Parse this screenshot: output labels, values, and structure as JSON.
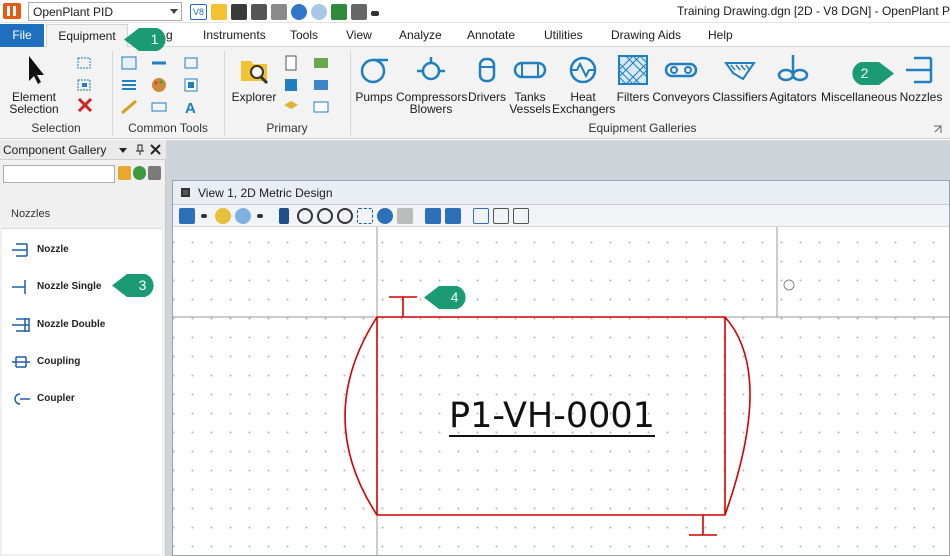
{
  "titlebar": {
    "workset": "OpenPlant PID",
    "window_title": "Training Drawing.dgn [2D - V8 DGN] - OpenPlant P",
    "qat_v8": "V8"
  },
  "tabs": {
    "file": "File",
    "equipment": "Equipment",
    "modeling_fragment": "g",
    "instruments": "Instruments",
    "tools": "Tools",
    "view": "View",
    "analyze": "Analyze",
    "annotate": "Annotate",
    "utilities": "Utilities",
    "drawing_aids": "Drawing Aids",
    "help": "Help"
  },
  "ribbon": {
    "selection": {
      "element_selection_line1": "Element",
      "element_selection_line2": "Selection",
      "label": "Selection"
    },
    "common_tools": {
      "label": "Common Tools"
    },
    "primary": {
      "explorer": "Explorer",
      "label": "Primary"
    },
    "galleries": {
      "pumps": "Pumps",
      "compressors_line1": "Compressors",
      "compressors_line2": "Blowers",
      "drivers": "Drivers",
      "tanks_line1": "Tanks",
      "tanks_line2": "Vessels",
      "heat_line1": "Heat",
      "heat_line2": "Exchangers",
      "filters": "Filters",
      "conveyors": "Conveyors",
      "classifiers": "Classifiers",
      "agitators": "Agitators",
      "miscellaneous": "Miscellaneous",
      "nozzles": "Nozzles",
      "label": "Equipment Galleries"
    }
  },
  "gallery": {
    "title": "Component Gallery",
    "search_value": "",
    "category": "Nozzles",
    "items": [
      {
        "label": "Nozzle"
      },
      {
        "label": "Nozzle Single"
      },
      {
        "label": "Nozzle Double"
      },
      {
        "label": "Coupling"
      },
      {
        "label": "Coupler"
      }
    ]
  },
  "view": {
    "title": "View 1, 2D Metric Design",
    "vessel_tag": "P1-VH-0001"
  },
  "callouts": [
    "1",
    "2",
    "3",
    "4"
  ],
  "colors": {
    "file_tab": "#1e6fbe",
    "callout": "#1a9b74",
    "vessel_stroke": "#d40000",
    "ribbon_icon": "#1e7fc1"
  }
}
